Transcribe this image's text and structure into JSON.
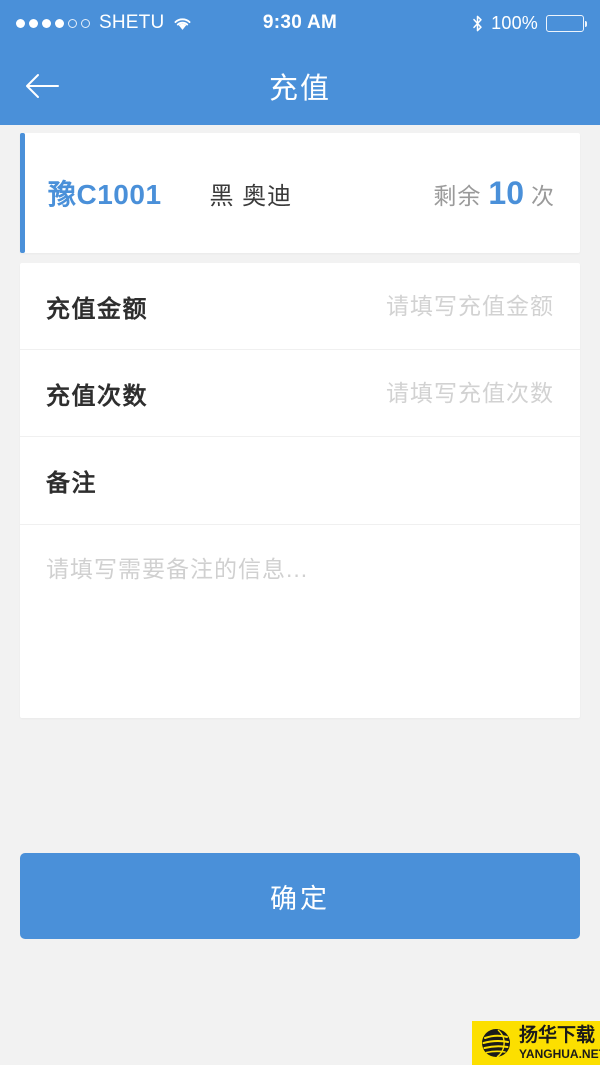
{
  "status_bar": {
    "signal_filled": 4,
    "signal_empty": 2,
    "carrier": "SHETU",
    "wifi_icon": "wifi-icon",
    "time": "9:30 AM",
    "bluetooth_icon": "bluetooth-icon",
    "battery_percent": "100%",
    "battery_icon": "battery-full-icon"
  },
  "nav": {
    "back_icon": "back-arrow-icon",
    "title": "充值"
  },
  "vehicle": {
    "plate": "豫C1001",
    "description": "黑 奥迪",
    "remaining_label": "剩余",
    "remaining_value": "10",
    "remaining_unit": "次"
  },
  "form": {
    "amount": {
      "label": "充值金额",
      "value": "",
      "placeholder": "请填写充值金额"
    },
    "times": {
      "label": "充值次数",
      "value": "",
      "placeholder": "请填写充值次数"
    },
    "remark": {
      "label": "备注",
      "value": "",
      "placeholder": "请填写需要备注的信息..."
    }
  },
  "actions": {
    "confirm_label": "确定"
  },
  "watermark": {
    "logo_icon": "yanghua-globe-icon",
    "chinese": "扬华下载",
    "english": "YANGHUA.NET"
  },
  "colors": {
    "brand_blue": "#4a90d9",
    "page_background": "#f2f2f2",
    "card_background": "#ffffff",
    "placeholder_gray": "#d2d2d2",
    "watermark_yellow": "#fcdf00"
  }
}
